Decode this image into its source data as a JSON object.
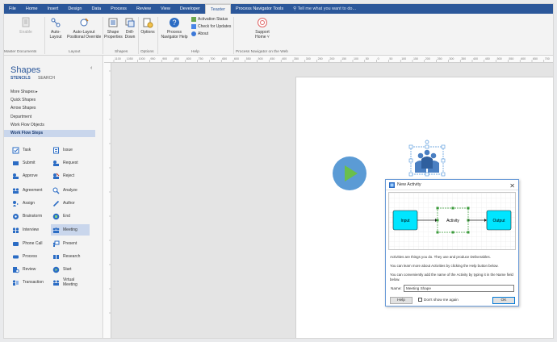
{
  "tabs": [
    "File",
    "Home",
    "Insert",
    "Design",
    "Data",
    "Process",
    "Review",
    "View",
    "Developer",
    "Teaster",
    "Process Navigator Tools"
  ],
  "active_tab": "Teaster",
  "tell_me": "Tell me what you want to do...",
  "ribbon": {
    "enable": "Enable",
    "auto_layout": "Auto-\nLayout",
    "auto_layout_override": "Auto-Layout\nPositional Override",
    "shape_properties": "Shape\nProperties",
    "drill_down": "Drill-\nDown",
    "options": "Options",
    "process_navigator_help": "Process\nNavigator Help",
    "activation_status": "Activation Status",
    "check_for_updates": "Check for Updates",
    "about": "About",
    "support_home": "Support\nHome ˅",
    "groups": {
      "master_documents": "Master Documents",
      "layout": "Layout",
      "shapes": "Shapes",
      "options": "Options",
      "help": "Help",
      "web": "Process Navigator on the Web"
    }
  },
  "shapes_panel": {
    "title": "Shapes",
    "collapse_glyph": "‹",
    "stencils_tab": "STENCILS",
    "search_tab": "SEARCH",
    "stencils": [
      "More Shapes  ▸",
      "Quick Shapes",
      "Arrow Shapes",
      "Department",
      "Work Flow Objects",
      "Work Flow Steps"
    ],
    "selected_stencil": "Work Flow Steps",
    "masters_left": [
      "Task",
      "Submit",
      "Approve",
      "Agreement",
      "Assign",
      "Brainstorm",
      "Interview",
      "Phone Call",
      "Process",
      "Review",
      "Transaction"
    ],
    "masters_right": [
      "Issue",
      "Request",
      "Reject",
      "Analyze",
      "Author",
      "End",
      "Meeting",
      "Present",
      "Research",
      "Start",
      "Virtual\nMeeting"
    ],
    "highlighted_master": "Meeting"
  },
  "ruler_ticks": [
    "1100",
    "1050",
    "1000",
    "950",
    "900",
    "850",
    "800",
    "750",
    "700",
    "650",
    "600",
    "550",
    "500",
    "450",
    "400",
    "350",
    "300",
    "250",
    "200",
    "150",
    "100",
    "50",
    "0",
    "50",
    "100",
    "150",
    "200",
    "250",
    "300",
    "350",
    "400",
    "450",
    "500",
    "550",
    "600",
    "650",
    "700"
  ],
  "dialog": {
    "title": "New Activity",
    "close": "✕",
    "diagram": {
      "input": "Input",
      "activity": "Activity",
      "output": "Output"
    },
    "line1": "Activities are things you do. They use and produce Deliverables.",
    "line2": "You can learn more about Activities by clicking the Help button below.",
    "line3": "You can conveniently add the name of the Activity by typing it in the Name field below.",
    "name_label": "Name:",
    "name_value": "Meeting Shape",
    "help_button": "Help",
    "dont_show": "Don't show me again",
    "ok_button": "OK"
  },
  "colors": {
    "accent": "#2b579a",
    "play": "#5b9bd5",
    "activity_fill": "#00e5ff"
  }
}
